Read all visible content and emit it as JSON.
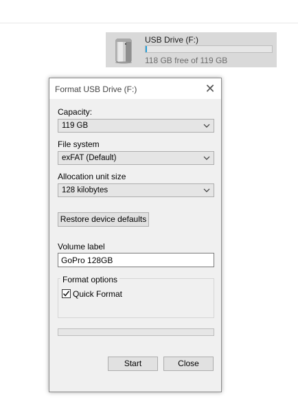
{
  "drive": {
    "name": "USB Drive (F:)",
    "free_text": "118 GB free of 119 GB",
    "used_fraction": 0.01,
    "bar_color": "#26a0da"
  },
  "dialog": {
    "title": "Format USB Drive (F:)",
    "capacity_label": "Capacity:",
    "capacity_value": "119 GB",
    "filesystem_label": "File system",
    "filesystem_value": "exFAT (Default)",
    "allocation_label": "Allocation unit size",
    "allocation_value": "128 kilobytes",
    "restore_button": "Restore device defaults",
    "volume_label_label": "Volume label",
    "volume_label_value": "GoPro 128GB",
    "format_options_label": "Format options",
    "quick_format_label": "Quick Format",
    "quick_format_checked": true,
    "progress_fraction": 0,
    "start_button": "Start",
    "close_button": "Close"
  },
  "icons": {
    "drive": "usb-drive-icon",
    "close": "close-icon",
    "dropdown": "chevron-down-icon",
    "check": "checkmark-icon"
  }
}
